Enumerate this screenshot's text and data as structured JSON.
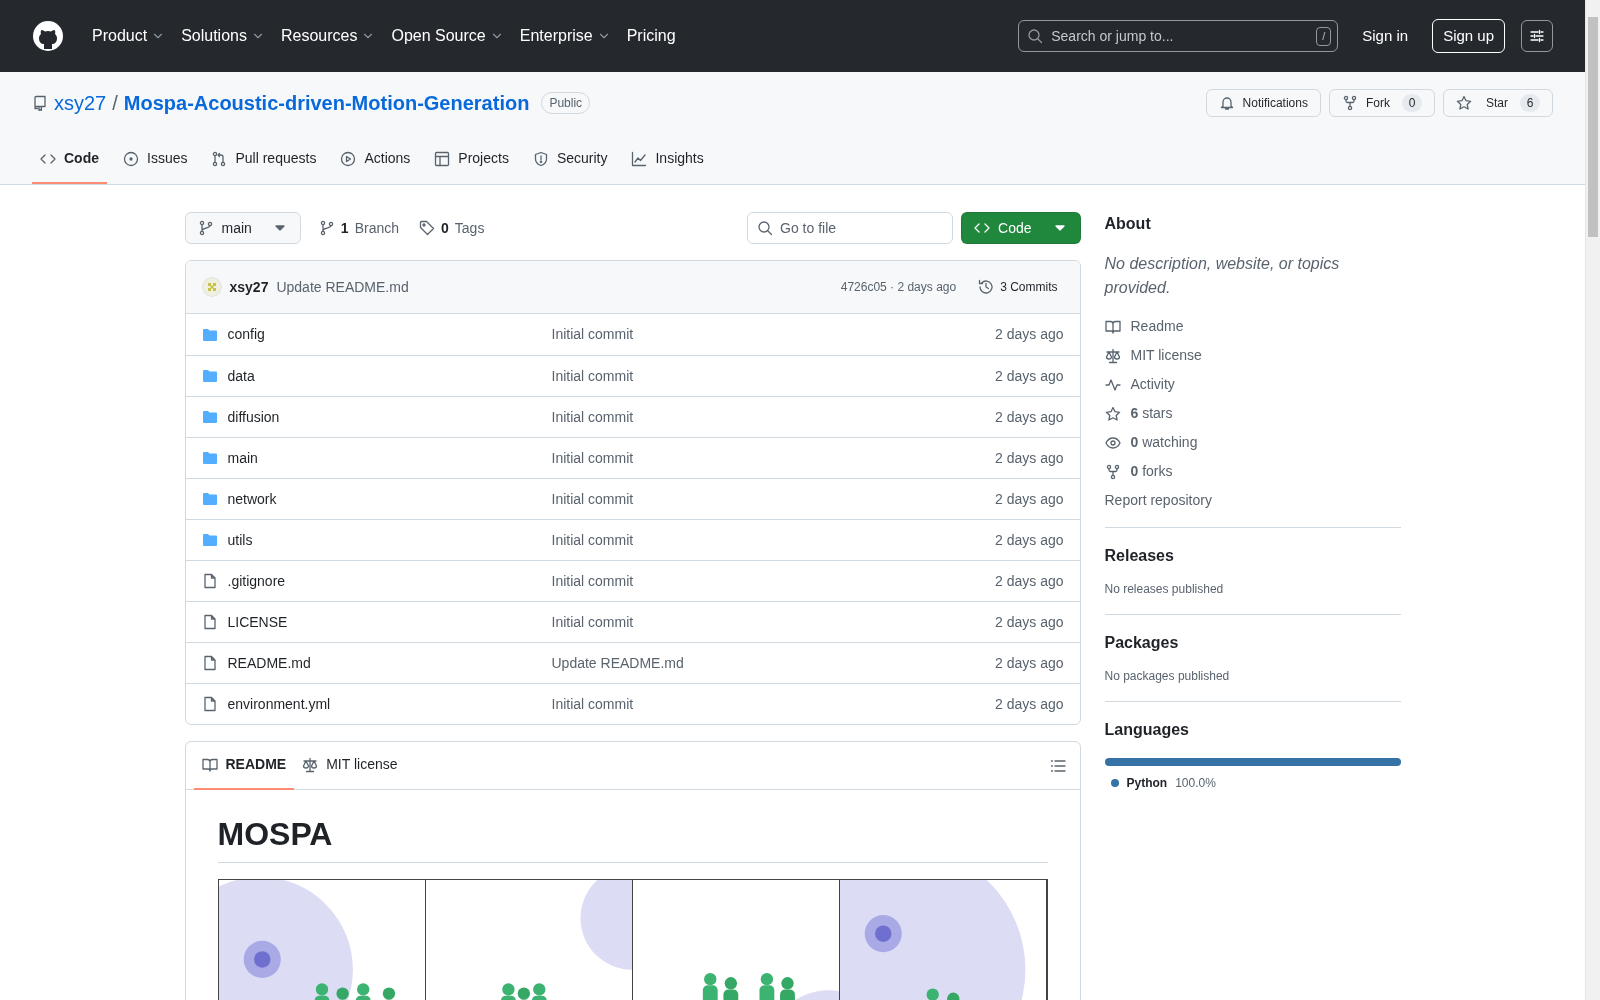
{
  "header": {
    "nav": [
      {
        "label": "Product",
        "dropdown": true
      },
      {
        "label": "Solutions",
        "dropdown": true
      },
      {
        "label": "Resources",
        "dropdown": true
      },
      {
        "label": "Open Source",
        "dropdown": true
      },
      {
        "label": "Enterprise",
        "dropdown": true
      },
      {
        "label": "Pricing",
        "dropdown": false
      }
    ],
    "search": {
      "placeholder": "Search or jump to...",
      "key": "/"
    },
    "sign_in": "Sign in",
    "sign_up": "Sign up"
  },
  "repo": {
    "owner": "xsy27",
    "separator": "/",
    "name": "Mospa-Acoustic-driven-Motion-Generation",
    "visibility": "Public",
    "notifications": "Notifications",
    "fork": {
      "label": "Fork",
      "count": "0"
    },
    "star": {
      "label": "Star",
      "count": "6"
    }
  },
  "tabs": [
    {
      "label": "Code",
      "selected": true
    },
    {
      "label": "Issues",
      "selected": false
    },
    {
      "label": "Pull requests",
      "selected": false
    },
    {
      "label": "Actions",
      "selected": false
    },
    {
      "label": "Projects",
      "selected": false
    },
    {
      "label": "Security",
      "selected": false
    },
    {
      "label": "Insights",
      "selected": false
    }
  ],
  "toolbar": {
    "branch": "main",
    "branches_count": "1",
    "branches_label": "Branch",
    "tags_count": "0",
    "tags_label": "Tags",
    "go_to_file": {
      "placeholder": "Go to file"
    },
    "code_button": "Code"
  },
  "commit": {
    "author": "xsy27",
    "message": "Update README.md",
    "hash_time": "4726c05 · 2 days ago",
    "commits": "3 Commits"
  },
  "files": [
    {
      "name": "config",
      "kind": "dir",
      "message": "Initial commit",
      "time": "2 days ago"
    },
    {
      "name": "data",
      "kind": "dir",
      "message": "Initial commit",
      "time": "2 days ago"
    },
    {
      "name": "diffusion",
      "kind": "dir",
      "message": "Initial commit",
      "time": "2 days ago"
    },
    {
      "name": "main",
      "kind": "dir",
      "message": "Initial commit",
      "time": "2 days ago"
    },
    {
      "name": "network",
      "kind": "dir",
      "message": "Initial commit",
      "time": "2 days ago"
    },
    {
      "name": "utils",
      "kind": "dir",
      "message": "Initial commit",
      "time": "2 days ago"
    },
    {
      "name": ".gitignore",
      "kind": "file",
      "message": "Initial commit",
      "time": "2 days ago"
    },
    {
      "name": "LICENSE",
      "kind": "file",
      "message": "Initial commit",
      "time": "2 days ago"
    },
    {
      "name": "README.md",
      "kind": "file",
      "message": "Update README.md",
      "time": "2 days ago"
    },
    {
      "name": "environment.yml",
      "kind": "file",
      "message": "Initial commit",
      "time": "2 days ago"
    }
  ],
  "readme": {
    "tabs": [
      {
        "label": "README",
        "selected": true
      },
      {
        "label": "MIT license",
        "selected": false
      }
    ],
    "heading": "MOSPA"
  },
  "about": {
    "heading": "About",
    "description": "No description, website, or topics provided.",
    "links": [
      "Readme",
      "MIT license",
      "Activity",
      "**6** stars",
      "**0** watching",
      "**0** forks"
    ],
    "report": "Report repository"
  },
  "releases": {
    "heading": "Releases",
    "note": "No releases published"
  },
  "packages": {
    "heading": "Packages",
    "note": "No packages published"
  },
  "languages": {
    "heading": "Languages",
    "items": [
      {
        "name": "Python",
        "percent": "100.0%",
        "level": 1,
        "color": "#3572a5"
      }
    ]
  }
}
